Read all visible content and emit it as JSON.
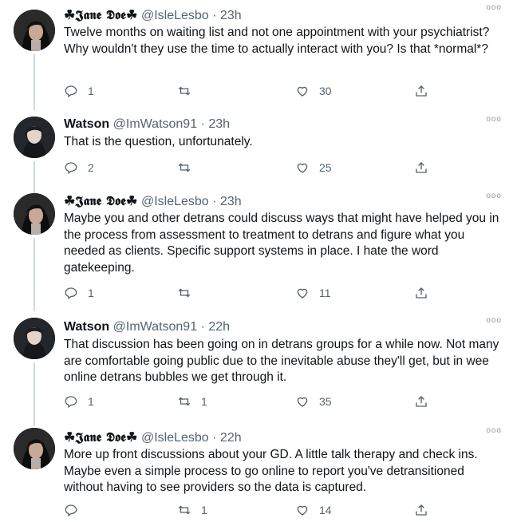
{
  "tweets": [
    {
      "name": "𝕵𝖆𝖓𝖊 𝕯𝖔𝖊",
      "name_prefix": "☘",
      "name_suffix": "☘",
      "handle": "@IsleLesbo",
      "time": "· 23h",
      "text": "Twelve months on waiting list and not one appointment with your psychiatrist? Why wouldn't they use the time to actually interact with you? Is that *normal*?",
      "replies": "1",
      "retweets": "",
      "likes": "30"
    },
    {
      "name": "Watson",
      "handle": "@ImWatson91",
      "time": "· 23h",
      "text": "That is the question, unfortunately.",
      "replies": "2",
      "retweets": "",
      "likes": "25"
    },
    {
      "name": "𝕵𝖆𝖓𝖊 𝕯𝖔𝖊",
      "name_prefix": "☘",
      "name_suffix": "☘",
      "handle": "@IsleLesbo",
      "time": "· 23h",
      "text": "Maybe you and other detrans could discuss ways that might have helped you in the process from assessment to treatment to detrans and figure what you needed as clients. Specific support systems in place. I hate the word gatekeeping.",
      "replies": "1",
      "retweets": "",
      "likes": "11"
    },
    {
      "name": "Watson",
      "handle": "@ImWatson91",
      "time": "· 22h",
      "text": "That discussion has been going on in detrans groups for a while now. Not many are comfortable going public due to the inevitable abuse they'll get, but in wee online detrans bubbles we get through it.",
      "replies": "1",
      "retweets": "1",
      "likes": "35"
    },
    {
      "name": "𝕵𝖆𝖓𝖊 𝕯𝖔𝖊",
      "name_prefix": "☘",
      "name_suffix": "☘",
      "handle": "@IsleLesbo",
      "time": "· 22h",
      "text": "More up front discussions about your GD. A little talk therapy and check ins. Maybe even a simple process to go online to report you've detransitioned without having to see providers so the data is captured.",
      "replies": "",
      "retweets": "1",
      "likes": "14"
    }
  ],
  "icons": {
    "reply": "reply-icon",
    "retweet": "retweet-icon",
    "like": "like-icon",
    "share": "share-icon",
    "more": "more-icon"
  },
  "more_glyph": "ooo"
}
